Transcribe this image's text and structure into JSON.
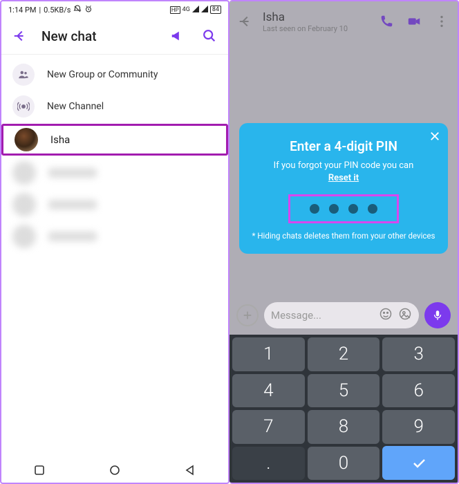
{
  "left": {
    "status": {
      "time": "1:14 PM",
      "speed": "0.5KB/s",
      "battery": "84"
    },
    "header": {
      "title": "New chat"
    },
    "menu": {
      "group": "New Group or Community",
      "channel": "New Channel"
    },
    "highlighted_contact": "Isha"
  },
  "right": {
    "header": {
      "name": "Isha",
      "status": "Last seen on February 10"
    },
    "modal": {
      "title": "Enter a 4-digit PIN",
      "subtitle": "If you forgot your PIN code you can",
      "reset": "Reset it",
      "note": "* Hiding chats deletes them from your other devices"
    },
    "input": {
      "placeholder": "Message..."
    },
    "keypad": [
      "1",
      "2",
      "3",
      "4",
      "5",
      "6",
      "7",
      "8",
      "9",
      ".",
      "0"
    ]
  }
}
